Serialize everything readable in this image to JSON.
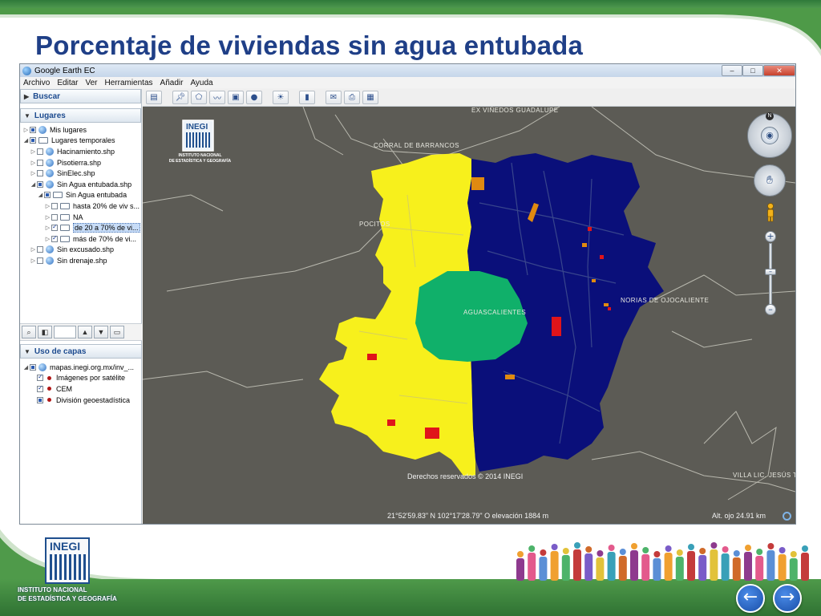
{
  "slide": {
    "title": "Porcentaje de viviendas sin agua entubada",
    "footer_org_line1": "INSTITUTO NACIONAL",
    "footer_org_line2": "DE ESTADÍSTICA Y GEOGRAFÍA",
    "footer_logo_word": "INEGI",
    "prev_icon": "arrow-left-icon",
    "next_icon": "arrow-right-icon"
  },
  "window": {
    "title": "Google Earth EC",
    "menu": [
      "Archivo",
      "Editar",
      "Ver",
      "Herramientas",
      "Añadir",
      "Ayuda"
    ]
  },
  "left_panel": {
    "search_label": "Buscar",
    "places_label": "Lugares",
    "places_tree": [
      {
        "label": "Mis lugares",
        "checked": "partial",
        "icon": "globe",
        "indent": 1,
        "expander": "▷"
      },
      {
        "label": "Lugares temporales",
        "checked": "partial",
        "icon": "folder-open",
        "indent": 1,
        "expander": "◢"
      },
      {
        "label": "Hacinamiento.shp",
        "checked": "none",
        "icon": "globe",
        "indent": 2,
        "expander": "▷"
      },
      {
        "label": "Pisotierra.shp",
        "checked": "none",
        "icon": "globe",
        "indent": 2,
        "expander": "▷"
      },
      {
        "label": "SinElec.shp",
        "checked": "none",
        "icon": "globe",
        "indent": 2,
        "expander": "▷"
      },
      {
        "label": "Sin Agua entubada.shp",
        "checked": "partial",
        "icon": "globe",
        "indent": 2,
        "expander": "◢"
      },
      {
        "label": "Sin Agua entubada",
        "checked": "partial",
        "icon": "folder-open",
        "indent": 3,
        "expander": "◢"
      },
      {
        "label": "hasta 20% de viv s...",
        "checked": "none",
        "icon": "folder",
        "indent": 4,
        "expander": "▷"
      },
      {
        "label": "NA",
        "checked": "none",
        "icon": "folder",
        "indent": 4,
        "expander": "▷"
      },
      {
        "label": "de 20 a 70% de vi...",
        "checked": "checked",
        "icon": "folder",
        "indent": 4,
        "expander": "▷",
        "selected": true
      },
      {
        "label": "más de 70% de vi...",
        "checked": "checked",
        "icon": "folder",
        "indent": 4,
        "expander": "▷"
      },
      {
        "label": "Sin excusado.shp",
        "checked": "none",
        "icon": "globe",
        "indent": 2,
        "expander": "▷"
      },
      {
        "label": "Sin drenaje.shp",
        "checked": "none",
        "icon": "globe",
        "indent": 2,
        "expander": "▷"
      }
    ],
    "layers_label": "Uso de capas",
    "layers_tree": [
      {
        "label": "mapas.inegi.org.mx/inv_...",
        "checked": "partial",
        "icon": "layers",
        "indent": 1,
        "expander": "◢"
      },
      {
        "label": "Imágenes por satélite",
        "checked": "checked",
        "icon": "dot",
        "indent": 2,
        "expander": ""
      },
      {
        "label": "CEM",
        "checked": "checked",
        "icon": "dot",
        "indent": 2,
        "expander": ""
      },
      {
        "label": "División geoestadística",
        "checked": "partial",
        "icon": "dot",
        "indent": 2,
        "expander": ""
      }
    ]
  },
  "toolbar": {
    "icons": [
      "sidebar-toggle-icon",
      "placemark-icon",
      "polygon-icon",
      "path-icon",
      "overlay-icon",
      "record-tour-icon",
      "sunlight-icon",
      "ruler-icon",
      "email-icon",
      "print-icon",
      "save-image-icon"
    ]
  },
  "map": {
    "labels": {
      "ex_vinedos": "EX VIÑEDOS GUADALUPE",
      "corral": "CORRAL DE BARRANCOS",
      "pocitos": "POCITOS",
      "aguascalientes": "AGUASCALIENTES",
      "norias": "NORIAS DE OJOCALIENTE",
      "villa": "VILLA LIC. JESÚS TE"
    },
    "copyright": "Derechos reservados © 2014 INEGI",
    "status_coords": "21°52'59.83\" N 102°17'28.79\" O elevación  1884 m",
    "status_eye": "Alt. ojo    24.91 km",
    "logo_word": "INEGI",
    "logo_line1": "INSTITUTO NACIONAL",
    "logo_line2": "DE ESTADÍSTICA Y GEOGRAFÍA",
    "compass_n": "N",
    "colors": {
      "background": "#5c5b55",
      "yellow_class": "#f7f01c",
      "blue_class": "#0a0f7a",
      "center_class": "#10b06a",
      "red_class": "#e0141a",
      "orange_class": "#e08a10"
    }
  }
}
